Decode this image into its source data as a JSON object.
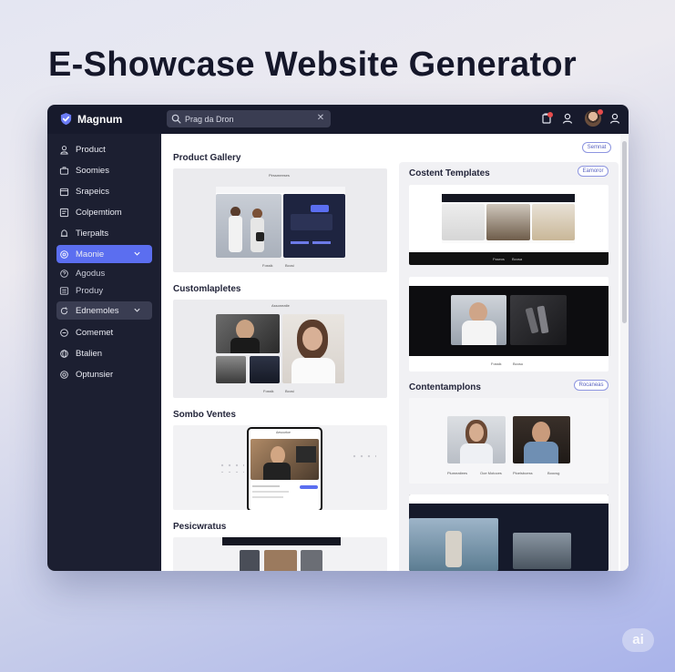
{
  "hero": {
    "title": "E-Showcase Website Generator"
  },
  "topbar": {
    "brand": "Magnum",
    "search": {
      "value": "Prag da Dron"
    }
  },
  "sidebar": {
    "items": [
      {
        "label": "Product",
        "icon": "user-icon"
      },
      {
        "label": "Soomies",
        "icon": "briefcase-icon"
      },
      {
        "label": "Srapeics",
        "icon": "calendar-icon"
      },
      {
        "label": "Colpemtiom",
        "icon": "layout-icon"
      },
      {
        "label": "Tierpalts",
        "icon": "bell-icon"
      },
      {
        "label": "Maonie",
        "icon": "gear-icon"
      },
      {
        "label": "Agodus",
        "icon": "help-icon"
      },
      {
        "label": "Produy",
        "icon": "list-icon"
      },
      {
        "label": "Ednemoles",
        "icon": "refresh-icon"
      },
      {
        "label": "Comemet",
        "icon": "chat-icon"
      },
      {
        "label": "Btalien",
        "icon": "globe-icon"
      },
      {
        "label": "Optunsier",
        "icon": "settings-icon"
      }
    ]
  },
  "main": {
    "top_pill": "Semnat",
    "left_sections": [
      {
        "title": "Product Gallery",
        "caption_a": "Fossik",
        "caption_b": "Bcosi",
        "header": "Pirssmeeses"
      },
      {
        "title": "Customlapletes",
        "caption_a": "Fossik",
        "caption_b": "Bcosi",
        "header": "Assoneatle"
      },
      {
        "title": "Sombo Ventes",
        "header": "Aesourtoe"
      },
      {
        "title": "Pesicwratus"
      }
    ],
    "right_sections": [
      {
        "title": "Costent Templates",
        "pill": "Eamoror",
        "caption_a": "Fsseos",
        "caption_b": "Bcosa"
      },
      {
        "caption_a": "Fossik",
        "caption_b": "Bcosu"
      },
      {
        "title": "Contentamplons",
        "pill": "Rocaneas",
        "captions": [
          "Plumeatiees",
          "Ooe Motoces",
          "Ploelsboess",
          "Boocsg"
        ]
      },
      {}
    ]
  },
  "watermark": "ai",
  "colors": {
    "accent": "#5b6ef0",
    "topbar": "#171a2c",
    "sidebar": "#1c1f31"
  }
}
